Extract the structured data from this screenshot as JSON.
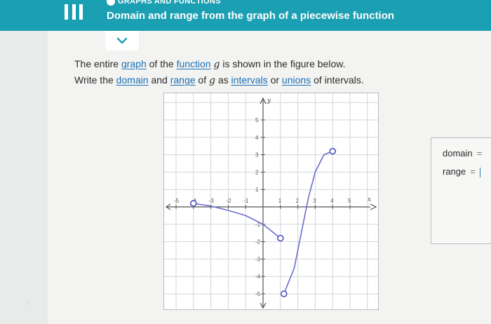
{
  "header": {
    "section": "GRAPHS AND FUNCTIONS",
    "title": "Domain and range from the graph of a piecewise function"
  },
  "problem": {
    "line1": {
      "t1": "The entire ",
      "link_graph": "graph",
      "t2": " of the ",
      "link_function": "function",
      "t3": " ",
      "var": "g",
      "t4": " is shown in the figure below."
    },
    "line2": {
      "t1": "Write the ",
      "link_domain": "domain",
      "t2": " and ",
      "link_range": "range",
      "t3": " of ",
      "var": "g",
      "t4": " as ",
      "link_intervals": "intervals",
      "t5": " or ",
      "link_unions": "unions",
      "t6": " of intervals."
    }
  },
  "answer": {
    "domain_label": "domain",
    "range_label": "range",
    "equals": "="
  },
  "chart_data": {
    "type": "line",
    "xlabel": "x",
    "ylabel": "y",
    "xlim": [
      -6,
      6
    ],
    "ylim": [
      -6,
      6
    ],
    "grid": true,
    "x_ticks": [
      "-5",
      "-4",
      "-3",
      "-2",
      "-1",
      "1",
      "2",
      "3",
      "4",
      "5"
    ],
    "y_ticks": [
      "5",
      "4",
      "3",
      "2",
      "1",
      "-1",
      "-2",
      "-3",
      "-4",
      "-5"
    ],
    "series": [
      {
        "points": [
          [
            -4,
            0.2
          ],
          [
            -3,
            0.05
          ],
          [
            -2,
            -0.2
          ],
          [
            -1,
            -0.5
          ],
          [
            0,
            -1.0
          ],
          [
            1,
            -1.8
          ]
        ],
        "start": {
          "x": -4,
          "y": 0.2,
          "style": "open"
        },
        "end": {
          "x": 1,
          "y": -1.8,
          "style": "open"
        }
      },
      {
        "points": [
          [
            1.2,
            -5
          ],
          [
            1.8,
            -3.5
          ],
          [
            2.3,
            -1
          ],
          [
            2.6,
            0.5
          ],
          [
            3,
            2
          ],
          [
            3.5,
            3
          ],
          [
            4,
            3.2
          ]
        ],
        "start": {
          "x": 1.2,
          "y": -5,
          "style": "open"
        },
        "end": {
          "x": 4,
          "y": 3.2,
          "style": "open"
        }
      }
    ]
  }
}
